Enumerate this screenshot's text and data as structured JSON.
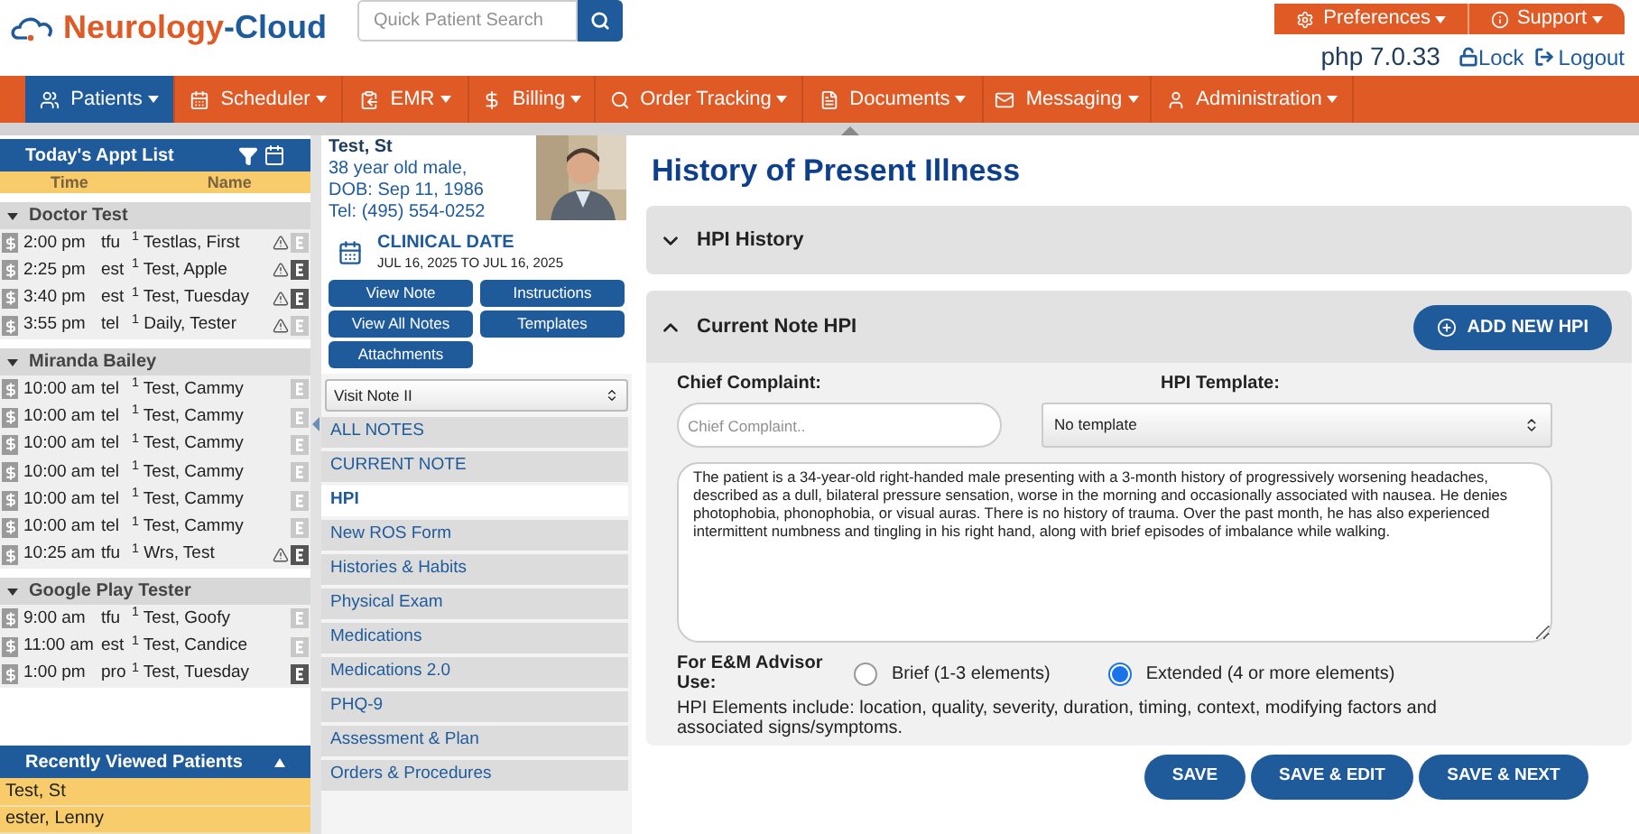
{
  "header": {
    "logo_a": "Neurology",
    "logo_b": "-Cloud",
    "search": {
      "placeholder": "Quick Patient Search"
    },
    "top_menu": [
      "Preferences",
      "Support"
    ],
    "version": "php 7.0.33",
    "links": [
      "Lock",
      "Logout"
    ]
  },
  "nav": [
    {
      "label": "Patients",
      "selected": true
    },
    {
      "label": "Scheduler",
      "selected": false
    },
    {
      "label": "EMR",
      "selected": false
    },
    {
      "label": "Billing",
      "selected": false
    },
    {
      "label": "Order Tracking",
      "selected": false
    },
    {
      "label": "Documents",
      "selected": false
    },
    {
      "label": "Messaging",
      "selected": false
    },
    {
      "label": "Administration",
      "selected": false
    }
  ],
  "appt_list": {
    "title": "Today's Appt List",
    "columns": [
      "Time",
      "Name"
    ],
    "groups": [
      {
        "name": "Doctor Test",
        "expanded": true,
        "rows": [
          {
            "time": "2:00 pm",
            "type": "tfu",
            "name": "$^{1}$ Testlas, First",
            "flag": true,
            "note": false
          },
          {
            "time": "2:25 pm",
            "type": "est",
            "name": "$^{1}$ Test, Apple",
            "flag": true,
            "note": true
          },
          {
            "time": "3:40 pm",
            "type": "est",
            "name": "$^{1}$ Test, Tuesday",
            "flag": true,
            "note": true
          },
          {
            "time": "3:55 pm",
            "type": "tel",
            "name": "$^{1}$ Daily, Tester",
            "flag": true,
            "note": false
          }
        ]
      },
      {
        "name": "Miranda Bailey",
        "expanded": true,
        "rows": [
          {
            "time": "10:00 am",
            "type": "tel",
            "name": "$^{1}$ Test, Cammy",
            "flag": false,
            "note": false
          },
          {
            "time": "10:00 am",
            "type": "tel",
            "name": "$^{1}$ Test, Cammy",
            "flag": false,
            "note": false
          },
          {
            "time": "10:00 am",
            "type": "tel",
            "name": "$^{1}$ Test, Cammy",
            "flag": false,
            "note": false
          },
          {
            "time": "10:00 am",
            "type": "tel",
            "name": "$^{1}$ Test, Cammy",
            "flag": false,
            "note": false
          },
          {
            "time": "10:00 am",
            "type": "tel",
            "name": "$^{1}$ Test, Cammy",
            "flag": false,
            "note": false
          },
          {
            "time": "10:00 am",
            "type": "tel",
            "name": "$^{1}$ Test, Cammy",
            "flag": false,
            "note": false
          },
          {
            "time": "10:25 am",
            "type": "tfu",
            "name": "$^{1}$ Wrs, Test",
            "flag": true,
            "note": true
          }
        ]
      },
      {
        "name": "Google Play Tester",
        "expanded": true,
        "rows": [
          {
            "time": "9:00 am",
            "type": "tfu",
            "name": "$^{1}$ Test, Goofy",
            "flag": false,
            "note": false
          },
          {
            "time": "11:00 am",
            "type": "est",
            "name": "$^{1}$ Test, Candice",
            "flag": false,
            "note": false
          },
          {
            "time": "1:00 pm",
            "type": "pro",
            "name": "$^{1}$ Test, Tuesday",
            "flag": false,
            "note": true
          }
        ]
      }
    ]
  },
  "recent": {
    "title": "Recently Viewed Patients",
    "expanded": true,
    "patients": [
      "Test, St",
      "ester, Lenny"
    ]
  },
  "patient": {
    "name": "Test, St",
    "lines": [
      "38 year old male,",
      "DOB: Sep 11, 1986",
      "Tel: (495) 554-0252"
    ],
    "clinical_date_label": "CLINICAL DATE",
    "clinical_date": "JUL 16, 2025 TO JUL 16, 2025",
    "buttons": [
      "View Note",
      "Instructions",
      "View All Notes",
      "Templates",
      "Attachments"
    ]
  },
  "note_menu": {
    "selector": "Visit Note II",
    "items": [
      {
        "label": "ALL NOTES",
        "selected": false
      },
      {
        "label": "CURRENT NOTE",
        "selected": false
      },
      {
        "label": "HPI",
        "selected": true
      },
      {
        "label": "New ROS Form",
        "selected": false
      },
      {
        "label": "Histories & Habits",
        "selected": false
      },
      {
        "label": "Physical Exam",
        "selected": false
      },
      {
        "label": "Medications",
        "selected": false
      },
      {
        "label": "Medications 2.0",
        "selected": false
      },
      {
        "label": "PHQ-9",
        "selected": false
      },
      {
        "label": "Assessment & Plan",
        "selected": false
      },
      {
        "label": "Orders & Procedures",
        "selected": false
      }
    ]
  },
  "hpi": {
    "title": "History of Present Illness",
    "sections": [
      {
        "title": "HPI History",
        "expanded": false
      },
      {
        "title": "Current Note HPI",
        "expanded": true
      }
    ],
    "add_button": "ADD NEW HPI",
    "chief_complaint": {
      "label": "Chief Complaint:",
      "placeholder": "Chief Complaint.."
    },
    "template": {
      "label": "HPI Template:",
      "value": "No template"
    },
    "narrative": "The patient is a 34-year-old right-handed male presenting with a 3-month history of progressively worsening headaches, described as a dull, bilateral pressure sensation, worse in the morning and occasionally associated with nausea. He denies photophobia, phonophobia, or visual auras. There is no history of trauma. Over the past month, he has also experienced intermittent numbness and tingling in his right hand, along with brief episodes of imbalance while walking.",
    "advisor_label": "For E&M Advisor Use:",
    "options": [
      {
        "label": "Brief (1-3 elements)",
        "selected": false
      },
      {
        "label": "Extended (4 or more elements)",
        "selected": true
      }
    ],
    "elements_note": "HPI Elements include: location, quality, severity, duration, timing, context, modifying factors and associated signs/symptoms."
  },
  "actions": [
    "SAVE",
    "SAVE & EDIT",
    "SAVE & NEXT"
  ]
}
